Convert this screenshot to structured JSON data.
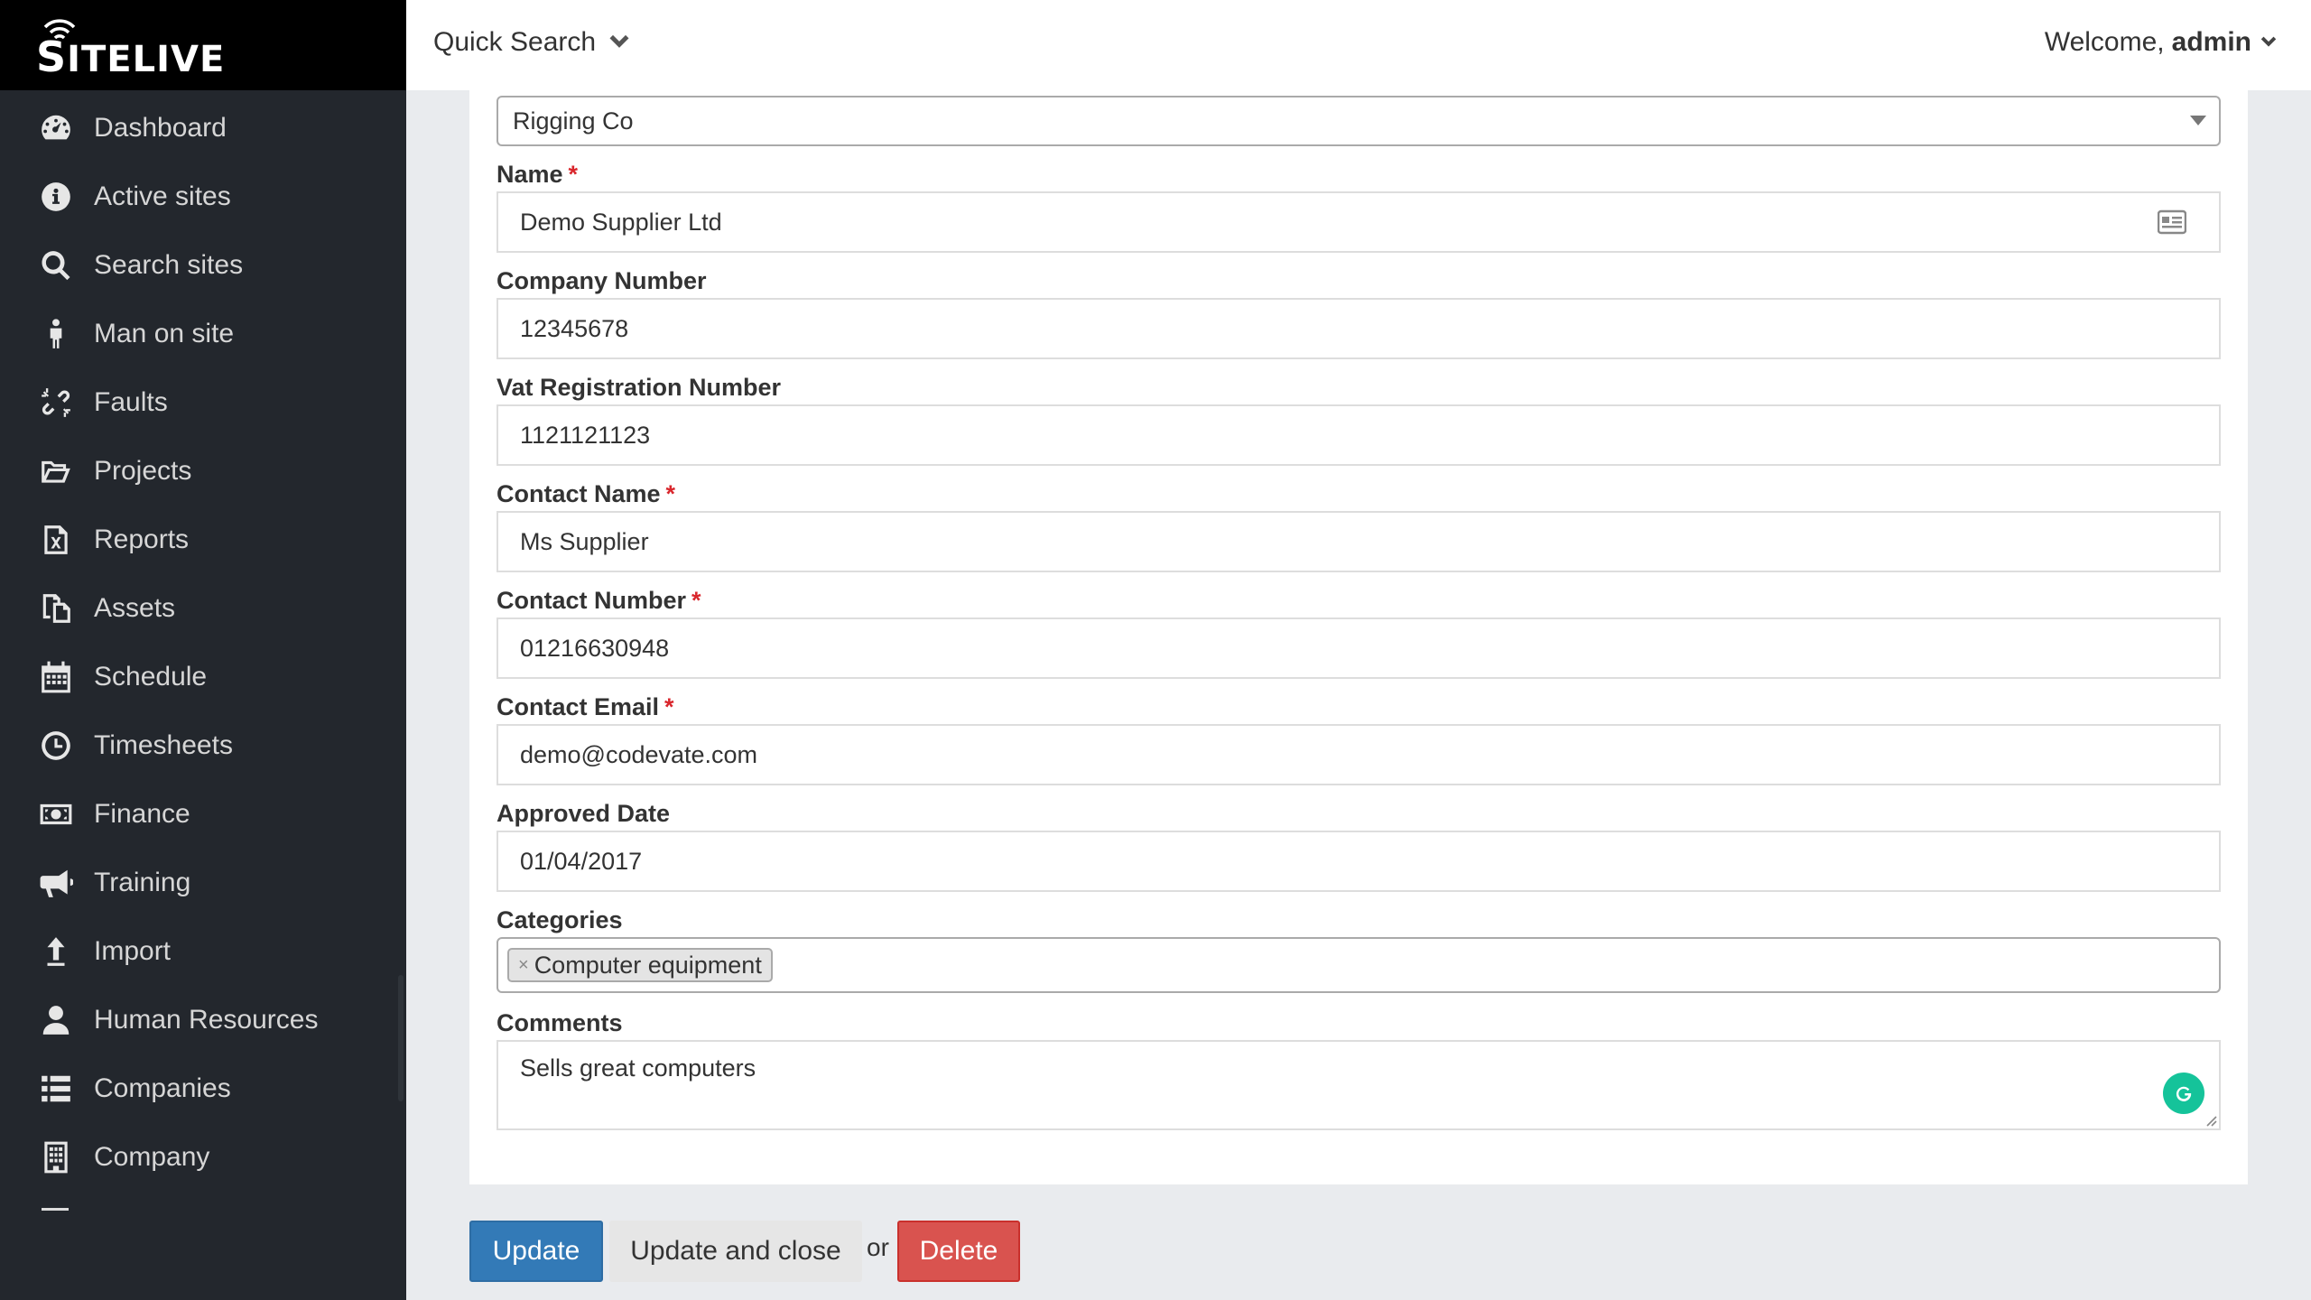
{
  "brand": {
    "name_first": "S",
    "name_rest": "ITELIVE"
  },
  "topbar": {
    "quick_search": "Quick Search",
    "welcome_prefix": "Welcome,",
    "welcome_user": "admin"
  },
  "sidebar": {
    "items": [
      {
        "label": "Dashboard",
        "icon": "dashboard-icon"
      },
      {
        "label": "Active sites",
        "icon": "info-icon"
      },
      {
        "label": "Search sites",
        "icon": "search-icon"
      },
      {
        "label": "Man on site",
        "icon": "person-icon"
      },
      {
        "label": "Faults",
        "icon": "broken-link-icon"
      },
      {
        "label": "Projects",
        "icon": "folder-open-icon"
      },
      {
        "label": "Reports",
        "icon": "excel-file-icon"
      },
      {
        "label": "Assets",
        "icon": "copy-files-icon"
      },
      {
        "label": "Schedule",
        "icon": "calendar-icon"
      },
      {
        "label": "Timesheets",
        "icon": "clock-icon"
      },
      {
        "label": "Finance",
        "icon": "money-icon"
      },
      {
        "label": "Training",
        "icon": "megaphone-icon"
      },
      {
        "label": "Import",
        "icon": "upload-arrow-icon"
      },
      {
        "label": "Human Resources",
        "icon": "user-icon"
      },
      {
        "label": "Companies",
        "icon": "list-icon"
      },
      {
        "label": "Company",
        "icon": "building-icon"
      }
    ]
  },
  "form": {
    "company_select": "Rigging Co",
    "name": {
      "label": "Name",
      "value": "Demo Supplier Ltd",
      "required": "*"
    },
    "company_number": {
      "label": "Company Number",
      "value": "12345678"
    },
    "vat": {
      "label": "Vat Registration Number",
      "value": "1121121123"
    },
    "contact_name": {
      "label": "Contact Name",
      "value": "Ms Supplier",
      "required": "*"
    },
    "contact_number": {
      "label": "Contact Number",
      "value": "01216630948",
      "required": "*"
    },
    "contact_email": {
      "label": "Contact Email",
      "value": "demo@codevate.com",
      "required": "*"
    },
    "approved_date": {
      "label": "Approved Date",
      "value": "01/04/2017"
    },
    "categories": {
      "label": "Categories",
      "tag_remove": "×",
      "tags": [
        "Computer equipment"
      ]
    },
    "comments": {
      "label": "Comments",
      "value": "Sells great computers"
    }
  },
  "actions": {
    "update": "Update",
    "update_close": "Update and close",
    "or": "or",
    "delete": "Delete"
  },
  "colors": {
    "sidebar_bg": "#23272d",
    "brand_bg": "#000000",
    "primary": "#337ab7",
    "danger": "#d9534f",
    "required": "#d9262c"
  }
}
